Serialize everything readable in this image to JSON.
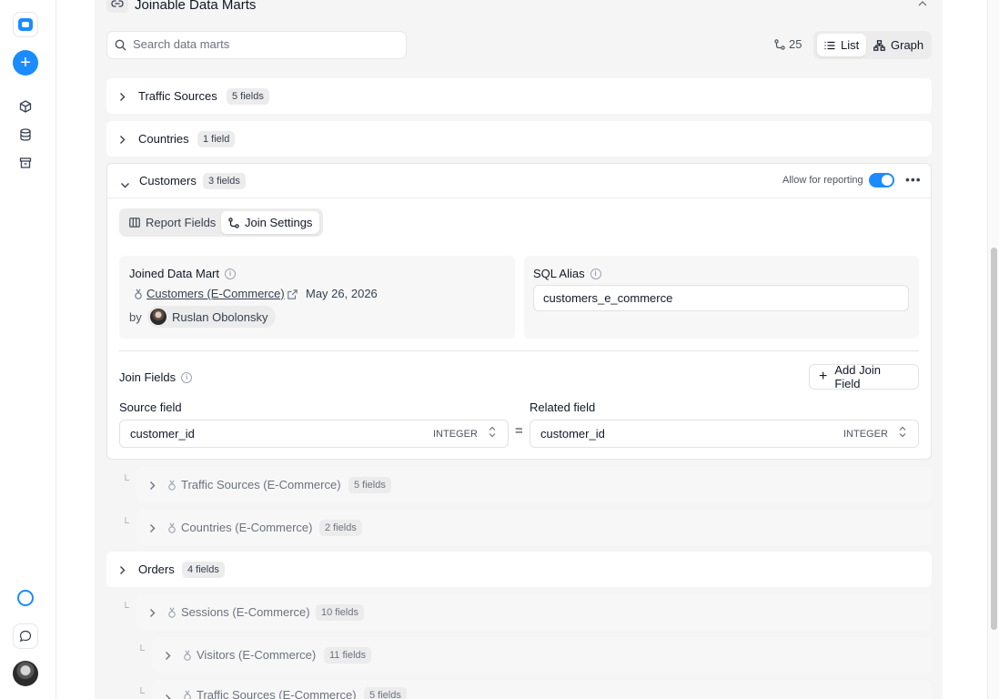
{
  "rail": {
    "icons": [
      "app-logo",
      "add-icon",
      "cube-icon",
      "database-icon",
      "archive-icon",
      "status-ring-icon",
      "chat-icon",
      "user-avatar"
    ]
  },
  "section": {
    "title": "Joinable Data Marts"
  },
  "search": {
    "placeholder": "Search data marts",
    "value": ""
  },
  "toolbar": {
    "count": "25",
    "list_label": "List",
    "graph_label": "Graph"
  },
  "marts": [
    {
      "name": "Traffic Sources",
      "fields": "5 fields"
    },
    {
      "name": "Countries",
      "fields": "1 field"
    }
  ],
  "customers": {
    "name": "Customers",
    "fields": "3 fields",
    "allow_label": "Allow for reporting",
    "allow_enabled": true,
    "tabs": {
      "report": "Report Fields",
      "join": "Join Settings"
    },
    "joined": {
      "label": "Joined Data Mart",
      "mart_name": "Customers (E-Commerce)",
      "date": "May 26, 2026",
      "by": "by",
      "owner": "Ruslan Obolonsky"
    },
    "sql": {
      "label": "SQL Alias",
      "value": "customers_e_commerce"
    },
    "join_fields": {
      "label": "Join Fields",
      "add_label": "Add Join Field",
      "source_label": "Source field",
      "related_label": "Related field",
      "equals": "=",
      "source": {
        "name": "customer_id",
        "type": "INTEGER"
      },
      "related": {
        "name": "customer_id",
        "type": "INTEGER"
      }
    },
    "children": [
      {
        "name": "Traffic Sources (E-Commerce)",
        "fields": "5 fields"
      },
      {
        "name": "Countries (E-Commerce)",
        "fields": "2 fields"
      }
    ]
  },
  "orders": {
    "name": "Orders",
    "fields": "4 fields",
    "children": [
      {
        "name": "Sessions (E-Commerce)",
        "fields": "10 fields"
      },
      {
        "name": "Visitors (E-Commerce)",
        "fields": "11 fields"
      },
      {
        "name": "Traffic Sources (E-Commerce)",
        "fields": "5 fields"
      }
    ]
  },
  "colors": {
    "accent": "#1a8cff",
    "panel": "#f5f5f5"
  }
}
